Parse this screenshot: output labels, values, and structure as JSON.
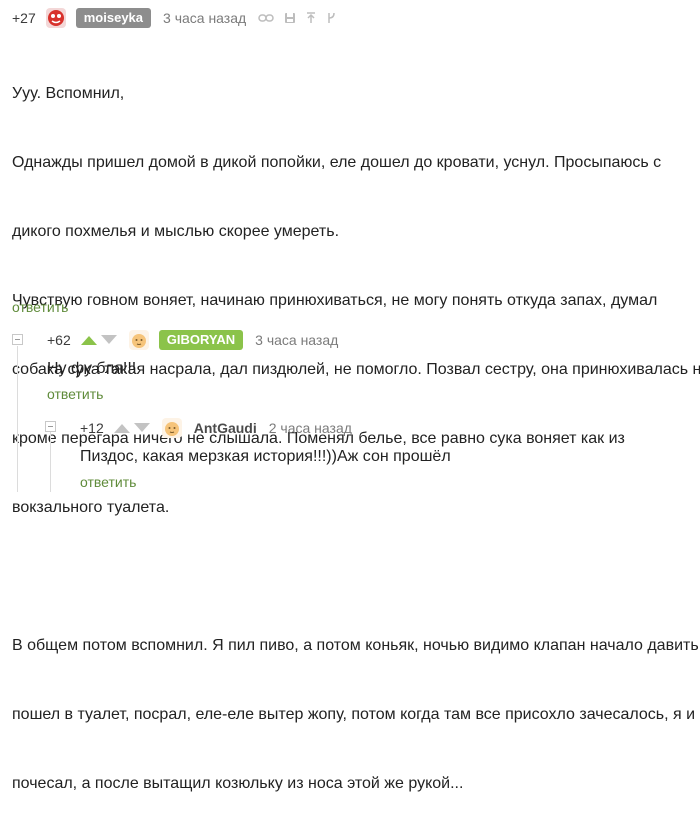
{
  "comment1": {
    "rating": "+27",
    "username": "moiseyka",
    "time": "3 часа назад",
    "lines": [
      "Ууу. Вспомнил,",
      "Однажды пришел домой в дикой попойки, еле дошел до кровати, уснул. Просыпаюсь с",
      "дикого похмелья и мыслью скорее умереть.",
      "Чувствую говном воняет, начинаю принюхиваться, не могу понять откуда запах, думал",
      "собака сука такая насрала, дал пиздюлей, не помогло. Позвал сестру, она принюхивалась но",
      "кроме перегара ничего не слышала. Поменял белье, все равно сука воняет как из",
      "вокзального туалета.",
      "",
      "В общем потом вспомнил. Я пил пиво, а потом коньяк, ночью видимо клапан начало давить",
      "пошел в туалет, посрал, еле-еле вытер жопу, потом когда там все присохло зачесалось, я и",
      "почесал, а после вытащил козюльку из носа этой же рукой..."
    ],
    "reply": "ответить"
  },
  "comment2": {
    "rating": "+62",
    "username": "GIBORYAN",
    "username_color": "#8bc34a",
    "time": "3 часа назад",
    "text": "Ну фу бля!!!",
    "reply": "ответить"
  },
  "comment3": {
    "rating": "+12",
    "username": "AntGaudi",
    "time": "2 часа назад",
    "text": "Пиздос, какая мерзкая история!!!))Аж сон прошёл",
    "reply": "ответить"
  },
  "colors": {
    "badge_gray": "#8d8d8d",
    "badge_green": "#8bc34a",
    "reply_link": "#5f8b3a",
    "vote_arrow": "#c3c3c3",
    "vote_up_active": "#8bc34a"
  }
}
